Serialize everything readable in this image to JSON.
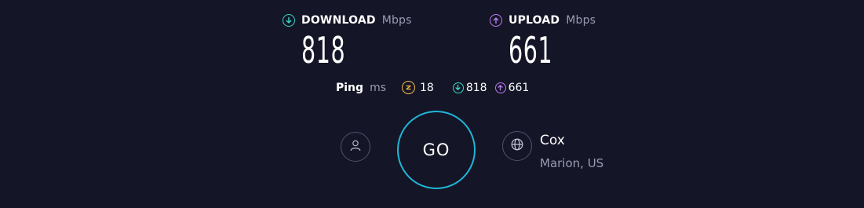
{
  "download": {
    "label": "DOWNLOAD",
    "unit": "Mbps",
    "value": "818",
    "icon": "download-arrow-icon",
    "color": "#3ad7c8"
  },
  "upload": {
    "label": "UPLOAD",
    "unit": "Mbps",
    "value": "661",
    "icon": "upload-arrow-icon",
    "color": "#b57cf0"
  },
  "ping": {
    "label": "Ping",
    "unit": "ms",
    "idle_latency": "18",
    "idle_icon": "latency-icon",
    "idle_color": "#f0b849",
    "download_latency": "818",
    "upload_latency": "661"
  },
  "go": {
    "label": "GO",
    "ring_color": "#1fb6d8"
  },
  "account": {
    "icon": "user-icon"
  },
  "server": {
    "icon": "globe-icon",
    "isp": "Cox",
    "location": "Marion, US"
  }
}
